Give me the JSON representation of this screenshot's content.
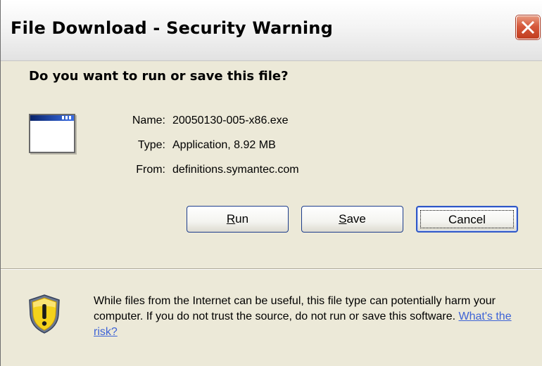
{
  "window": {
    "title": "File Download - Security Warning"
  },
  "prompt": {
    "question": "Do you want to run or save this file?"
  },
  "file": {
    "name_label": "Name:",
    "name_value": "20050130-005-x86.exe",
    "type_label": "Type:",
    "type_value": "Application, 8.92 MB",
    "from_label": "From:",
    "from_value": "definitions.symantec.com"
  },
  "buttons": {
    "run": {
      "accesskey": "R",
      "rest": "un"
    },
    "save": {
      "accesskey": "S",
      "rest": "ave"
    },
    "cancel": "Cancel"
  },
  "warning": {
    "text": "While files from the Internet can be useful, this file type can potentially harm your computer. If you do not trust the source, do not run or save this software. ",
    "link": "What's the risk?"
  },
  "icons": {
    "close": "close-icon",
    "file": "application-window-icon",
    "warning": "security-shield-warning-icon"
  },
  "colors": {
    "dialog_background": "#ece9d8",
    "close_button": "#d6593c",
    "link": "#3d63d6",
    "shield": "#f3d21c"
  }
}
